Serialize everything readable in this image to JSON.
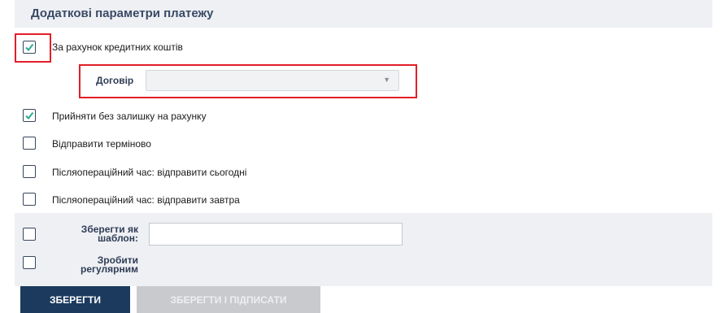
{
  "section": {
    "title": "Додаткові параметри платежу"
  },
  "options": {
    "credit_funds": {
      "label": "За рахунок кредитних коштів",
      "checked": true
    },
    "contract": {
      "label": "Договір",
      "value": ""
    },
    "no_balance": {
      "label": "Прийняти без залишку на рахунку",
      "checked": true
    },
    "urgent": {
      "label": "Відправити терміново",
      "checked": false
    },
    "after_today": {
      "label": "Післяопераційний час: відправити сьогодні",
      "checked": false
    },
    "after_tomorrow": {
      "label": "Післяопераційний час: відправити завтра",
      "checked": false
    }
  },
  "template": {
    "save_as_template_line1": "Зберегти як",
    "save_as_template_line2": "шаблон:",
    "template_name_value": "",
    "save_as_template_checked": false,
    "make_regular_line1": "Зробити",
    "make_regular_line2": "регулярним",
    "make_regular_checked": false
  },
  "buttons": {
    "save": "ЗБЕРЕГТИ",
    "save_and_sign": "ЗБЕРЕГТИ І ПІДПИСАТИ"
  },
  "colors": {
    "highlight_border": "#e21e26",
    "primary_button": "#1b3a5e",
    "disabled_button": "#c8cacd",
    "checkmark": "#2eaa8f"
  }
}
